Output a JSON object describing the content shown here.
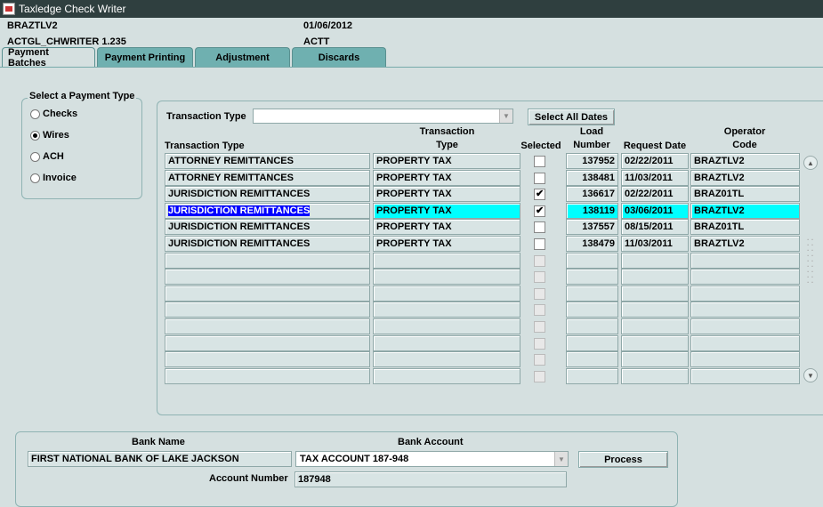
{
  "window": {
    "title": "Taxledge Check Writer"
  },
  "header": {
    "user": "BRAZTLV2",
    "date": "01/06/2012",
    "module": "ACTGL_CHWRITER 1.235",
    "code": "ACTT"
  },
  "tabs": [
    "Payment Batches",
    "Payment Printing",
    "Adjustment",
    "Discards"
  ],
  "payment_type": {
    "title": "Select a Payment Type",
    "options": [
      "Checks",
      "Wires",
      "ACH",
      "Invoice"
    ],
    "selected": "Wires"
  },
  "filter": {
    "label": "Transaction Type",
    "value": "",
    "select_all_button": "Select All Dates"
  },
  "table": {
    "headers": {
      "transaction_type": "Transaction Type",
      "transaction_type2_line1": "Transaction",
      "transaction_type2_line2": "Type",
      "selected": "Selected",
      "load_line1": "Load",
      "load_line2": "Number",
      "request_date": "Request Date",
      "operator_line1": "Operator",
      "operator_line2": "Code"
    },
    "rows": [
      {
        "type": "ATTORNEY REMITTANCES",
        "tx": "PROPERTY TAX",
        "selected": false,
        "load": "137952",
        "date": "02/22/2011",
        "op": "BRAZTLV2"
      },
      {
        "type": "ATTORNEY REMITTANCES",
        "tx": "PROPERTY TAX",
        "selected": false,
        "load": "138481",
        "date": "11/03/2011",
        "op": "BRAZTLV2"
      },
      {
        "type": "JURISDICTION REMITTANCES",
        "tx": "PROPERTY TAX",
        "selected": true,
        "load": "136617",
        "date": "02/22/2011",
        "op": "BRAZ01TL"
      },
      {
        "type": "JURISDICTION REMITTANCES",
        "tx": "PROPERTY TAX",
        "selected": true,
        "load": "138119",
        "date": "03/06/2011",
        "op": "BRAZTLV2"
      },
      {
        "type": "JURISDICTION REMITTANCES",
        "tx": "PROPERTY TAX",
        "selected": false,
        "load": "137557",
        "date": "08/15/2011",
        "op": "BRAZ01TL"
      },
      {
        "type": "JURISDICTION REMITTANCES",
        "tx": "PROPERTY TAX",
        "selected": false,
        "load": "138479",
        "date": "11/03/2011",
        "op": "BRAZTLV2"
      }
    ]
  },
  "bank": {
    "bank_name_label": "Bank Name",
    "bank_name": "FIRST NATIONAL BANK OF LAKE JACKSON",
    "bank_account_label": "Bank Account",
    "bank_account": "TAX ACCOUNT 187-948",
    "process_button": "Process",
    "account_number_label": "Account Number",
    "account_number": "187948"
  },
  "colors": {
    "highlight_row": "#00ffff",
    "selection": "#0000ff",
    "background": "#d5e0e0"
  }
}
